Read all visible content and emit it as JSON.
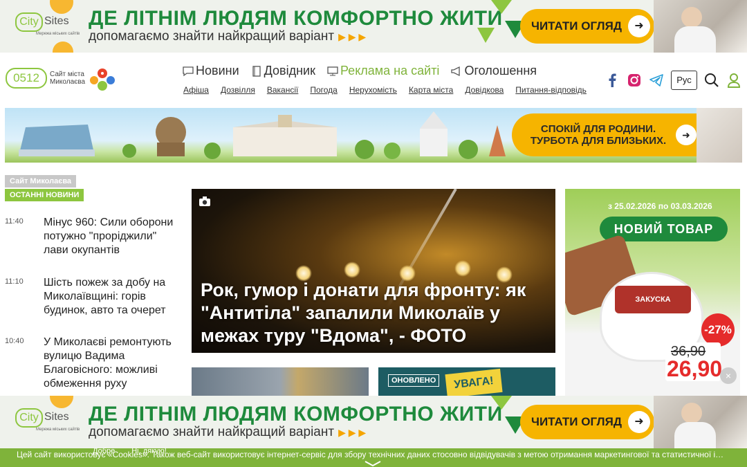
{
  "promo": {
    "logo_word1": "City",
    "logo_word2": "Sites",
    "logo_sub": "Мережа міських сайтів",
    "headline": "ДЕ ЛІТНІМ ЛЮДЯМ КОМФОРТНО ЖИТИ",
    "subline": "допомагаємо знайти найкращий варіант",
    "triangles": "▶ ▶ ▶",
    "cta": "ЧИТАТИ ОГЛЯД",
    "cta_arrow": "➜"
  },
  "header": {
    "logo_code": "0512",
    "logo_name": "Сайт міста Миколаєва",
    "main_nav": [
      {
        "label": "Новини",
        "icon": "chat-icon"
      },
      {
        "label": "Довідник",
        "icon": "book-icon"
      },
      {
        "label": "Реклама на сайті",
        "icon": "monitor-icon"
      },
      {
        "label": "Оголошення",
        "icon": "megaphone-icon"
      }
    ],
    "sub_nav": [
      "Афіша",
      "Дозвілля",
      "Вакансії",
      "Погода",
      "Нерухомість",
      "Карта міста",
      "Довідкова",
      "Питання-відповідь"
    ],
    "lang": "Рус"
  },
  "city_banner": {
    "ad_text": "СПОКІЙ ДЛЯ РОДИНИ. ТУРБОТА ДЛЯ БЛИЗЬКИХ.",
    "ad_arrow": "➜"
  },
  "sidebar": {
    "site_tag": "Сайт Миколаєва",
    "section_tag": "ОСТАННІ НОВИНИ",
    "news": [
      {
        "time": "11:40",
        "title": "Мінус 960: Сили оборони потужно \"проріджили\" лави окупантів"
      },
      {
        "time": "11:10",
        "title": "Шість пожеж за добу на Миколаївщині: горів будинок, авто та очерет"
      },
      {
        "time": "10:40",
        "title": "У Миколаєві ремонтують вулицю Вадима Благовісного: можливі обмеження руху"
      }
    ]
  },
  "featured": {
    "title": "Рок, гумор і донати для фронту: як \"Антитіла\" запалили Миколаїв у межах туру \"Вдома\", - ФОТО"
  },
  "thumb2": {
    "badge": "ОНОВЛЕНО",
    "sign": "УВАГА!"
  },
  "right_ad": {
    "dates": "з 25.02.2026 по 03.03.2026",
    "new_label": "НОВИЙ ТОВАР",
    "product": "ЗАКУСКА",
    "discount": "-27%",
    "old_price": "36,90",
    "new_price": "26,90",
    "close": "×"
  },
  "cookie": {
    "text": "Цей сайт використовує «Cookies». Також веб-сайт використовує інтернет-сервіс для збору технічних даних стосовно відвідувачів з метою отримання маркетингової та статистичної і…",
    "accept": "Добре",
    "decline": "Ні, дякую!"
  },
  "colors": {
    "accent_green": "#8dc63f",
    "brand_dark_green": "#1e8a3c",
    "cta_yellow": "#f6b400",
    "cookie_bar": "#7fb33a"
  }
}
